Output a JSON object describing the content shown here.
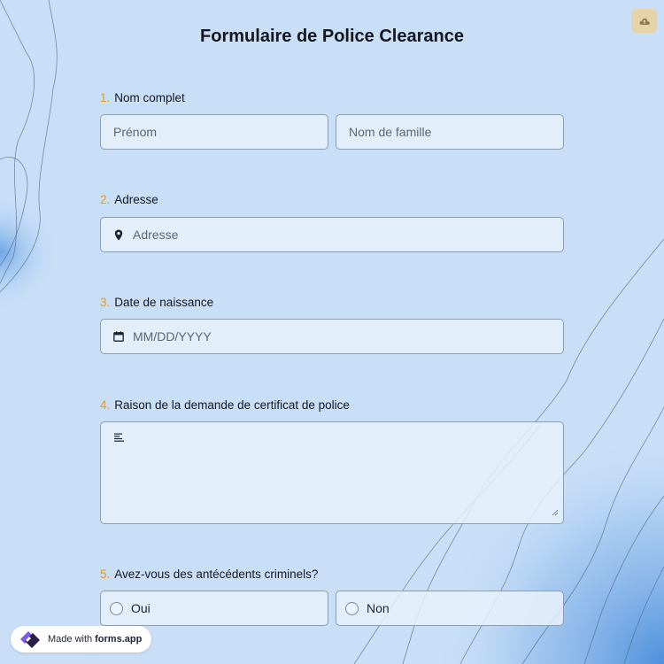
{
  "form": {
    "title": "Formulaire de Police Clearance",
    "save_icon": "cloud-upload-icon",
    "colors": {
      "accent_number": "#e39a1d",
      "background": "#c9dff7",
      "field_border": "#8a9db3"
    }
  },
  "questions": [
    {
      "number": "1.",
      "label": "Nom complet",
      "fields": [
        "Prénom",
        "Nom de famille"
      ]
    },
    {
      "number": "2.",
      "label": "Adresse",
      "placeholder": "Adresse",
      "icon": "location-pin-icon"
    },
    {
      "number": "3.",
      "label": "Date de naissance",
      "placeholder": "MM/DD/YYYY",
      "icon": "calendar-icon"
    },
    {
      "number": "4.",
      "label": "Raison de la demande de certificat de police",
      "icon": "text-lines-icon"
    },
    {
      "number": "5.",
      "label": "Avez-vous des antécédents criminels?",
      "options": [
        "Oui",
        "Non"
      ]
    }
  ],
  "badge": {
    "prefix": "Made with",
    "brand": "forms.app"
  }
}
